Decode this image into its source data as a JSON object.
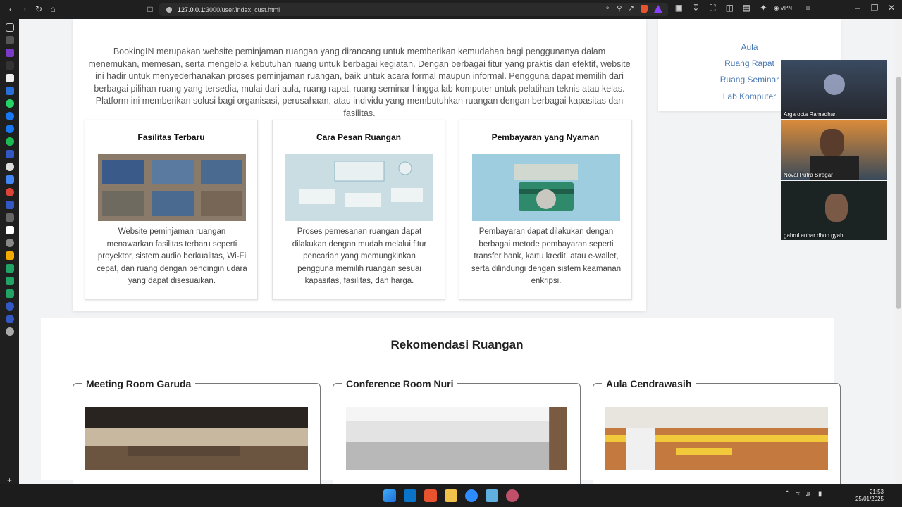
{
  "browser": {
    "url_host": "127.0.0.1",
    "url_path": ":3000/user/index_cust.html",
    "vpn_label": "VPN"
  },
  "about": {
    "text": "BookingIN merupakan website peminjaman ruangan yang dirancang untuk memberikan kemudahan bagi penggunanya dalam menemukan, memesan, serta mengelola kebutuhan ruang untuk berbagai kegiatan. Dengan berbagai fitur yang praktis dan efektif, website ini hadir untuk menyederhanakan proses peminjaman ruangan, baik untuk acara formal maupun informal. Pengguna dapat memilih dari berbagai pilihan ruang yang tersedia, mulai dari aula, ruang rapat, ruang seminar hingga lab komputer untuk pelatihan teknis atau kelas. Platform ini memberikan solusi bagi organisasi, perusahaan, atau individu yang membutuhkan ruangan dengan berbagai kapasitas dan fasilitas."
  },
  "features": [
    {
      "title": "Fasilitas Terbaru",
      "text": "Website peminjaman ruangan menawarkan fasilitas terbaru seperti proyektor, sistem audio berkualitas, Wi-Fi cepat, dan ruang dengan pendingin udara yang dapat disesuaikan."
    },
    {
      "title": "Cara Pesan Ruangan",
      "text": "Proses pemesanan ruangan dapat dilakukan dengan mudah melalui fitur pencarian yang memungkinkan pengguna memilih ruangan sesuai kapasitas, fasilitas, dan harga."
    },
    {
      "title": "Pembayaran yang Nyaman",
      "text": "Pembayaran dapat dilakukan dengan berbagai metode pembayaran seperti transfer bank, kartu kredit, atau e-wallet, serta dilindungi dengan sistem keamanan enkripsi."
    }
  ],
  "room_menu": [
    "Aula",
    "Ruang Rapat",
    "Ruang Seminar",
    "Lab Komputer"
  ],
  "recommendations": {
    "title": "Rekomendasi Ruangan",
    "rooms": [
      "Meeting Room Garuda",
      "Conference Room Nuri",
      "Aula Cendrawasih"
    ]
  },
  "video_participants": [
    "Arga octa Ramadhan",
    "Noval Putra Siregar",
    "gahrul anhar dhon gyah"
  ],
  "clock": {
    "time": "21:53",
    "date": "25/01/2025"
  },
  "colors": {
    "link": "#4a78b5",
    "page_bg": "#f1f3f5",
    "taskbar": "#1c1c1c"
  }
}
